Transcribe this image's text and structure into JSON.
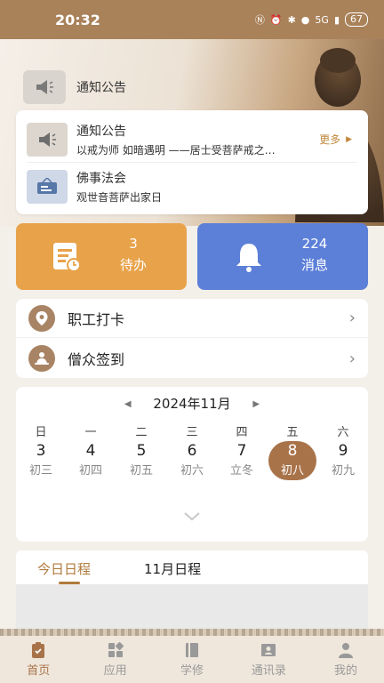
{
  "status_bar": {
    "time": "20:32",
    "network": "5G",
    "battery": "67"
  },
  "notice_header": {
    "label": "通知公告"
  },
  "announcements": [
    {
      "title": "通知公告",
      "subtitle": "以戒为师 如暗遇明 ——居士受菩萨戒之…",
      "icon": "megaphone-icon"
    },
    {
      "title": "佛事法会",
      "subtitle": "观世音菩萨出家日",
      "icon": "signboard-icon"
    }
  ],
  "more_label": "更多",
  "tiles": {
    "todo": {
      "count": "3",
      "label": "待办",
      "color": "#e8a24a"
    },
    "messages": {
      "count": "224",
      "label": "消息",
      "color": "#5c7fd8"
    }
  },
  "menu": [
    {
      "label": "职工打卡",
      "icon": "location-pin-icon"
    },
    {
      "label": "僧众签到",
      "icon": "meditation-icon"
    }
  ],
  "calendar": {
    "month": "2024年11月",
    "weekdays": [
      "日",
      "一",
      "二",
      "三",
      "四",
      "五",
      "六"
    ],
    "days": [
      {
        "date": "3",
        "lunar": "初三"
      },
      {
        "date": "4",
        "lunar": "初四"
      },
      {
        "date": "5",
        "lunar": "初五"
      },
      {
        "date": "6",
        "lunar": "初六"
      },
      {
        "date": "7",
        "lunar": "立冬"
      },
      {
        "date": "8",
        "lunar": "初八",
        "selected": true
      },
      {
        "date": "9",
        "lunar": "初九"
      }
    ]
  },
  "schedule_tabs": [
    {
      "label": "今日日程",
      "active": true
    },
    {
      "label": "11月日程",
      "active": false
    }
  ],
  "bottom_nav": [
    {
      "label": "首页",
      "icon": "home-clipboard-icon",
      "active": true
    },
    {
      "label": "应用",
      "icon": "apps-grid-icon",
      "active": false
    },
    {
      "label": "学修",
      "icon": "book-icon",
      "active": false
    },
    {
      "label": "通讯录",
      "icon": "contacts-icon",
      "active": false
    },
    {
      "label": "我的",
      "icon": "user-icon",
      "active": false
    }
  ],
  "colors": {
    "accent": "#a9734a",
    "brand_brown": "#a9825a",
    "todo": "#e8a24a",
    "message": "#5c7fd8"
  }
}
